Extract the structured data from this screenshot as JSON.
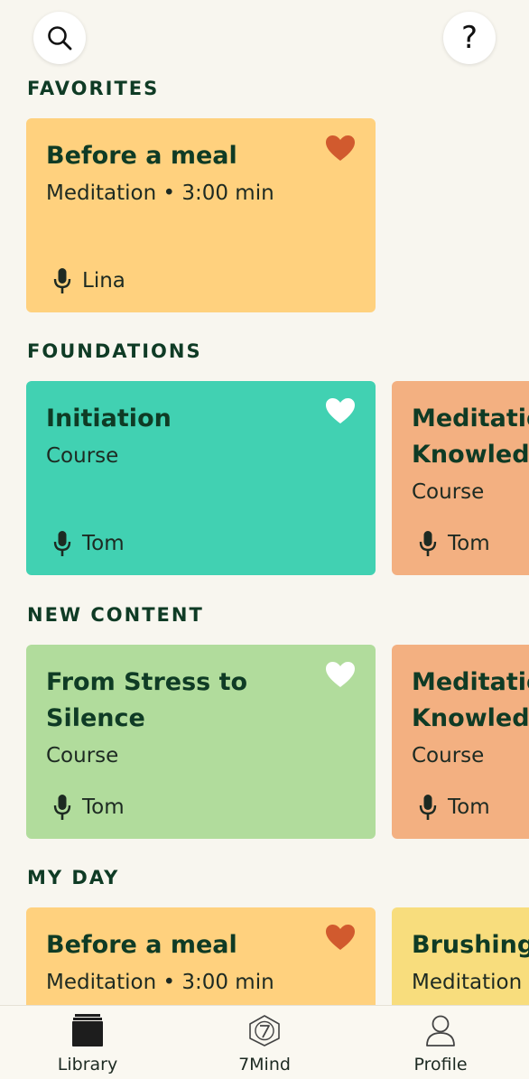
{
  "header": {
    "help_glyph": "?",
    "search_icon": "search-icon"
  },
  "sections": {
    "favorites": {
      "title": "FAVORITES"
    },
    "foundations": {
      "title": "FOUNDATIONS"
    },
    "new_content": {
      "title": "NEW CONTENT"
    },
    "my_day": {
      "title": "MY DAY"
    }
  },
  "cards": {
    "fav_meal": {
      "title": "Before a meal",
      "subtitle": "Meditation • 3:00 min",
      "narrator": "Lina",
      "favorited": true,
      "color": "#ffd17e"
    },
    "found_initiation": {
      "title": "Initiation",
      "subtitle": "Course",
      "narrator": "Tom",
      "favorited": false,
      "color": "#41d1b2"
    },
    "found_knowledge": {
      "title": "Meditation Knowledge",
      "subtitle": "Course",
      "narrator": "Tom",
      "color": "#f3b081"
    },
    "new_stress": {
      "title": "From Stress to Silence",
      "subtitle": "Course",
      "narrator": "Tom",
      "favorited": false,
      "color": "#b1dc9c"
    },
    "new_knowledge": {
      "title": "Meditation Knowledge",
      "subtitle": "Course",
      "narrator": "Tom",
      "color": "#f3b081"
    },
    "day_meal": {
      "title": "Before a meal",
      "subtitle": "Meditation • 3:00 min",
      "favorited": true,
      "color": "#ffd17e"
    },
    "day_brushing": {
      "title": "Brushing your teeth",
      "subtitle": "Meditation",
      "color": "#f8dd7d"
    }
  },
  "colors": {
    "heart_active": "#d15a2e",
    "heart_inactive": "#ffffff",
    "heading": "#0f3b25"
  },
  "tabbar": {
    "library": {
      "label": "Library",
      "icon": "library-icon"
    },
    "seven_mind": {
      "label": "7Mind",
      "icon": "seven-mind-logo-icon"
    },
    "profile": {
      "label": "Profile",
      "icon": "profile-icon"
    }
  }
}
